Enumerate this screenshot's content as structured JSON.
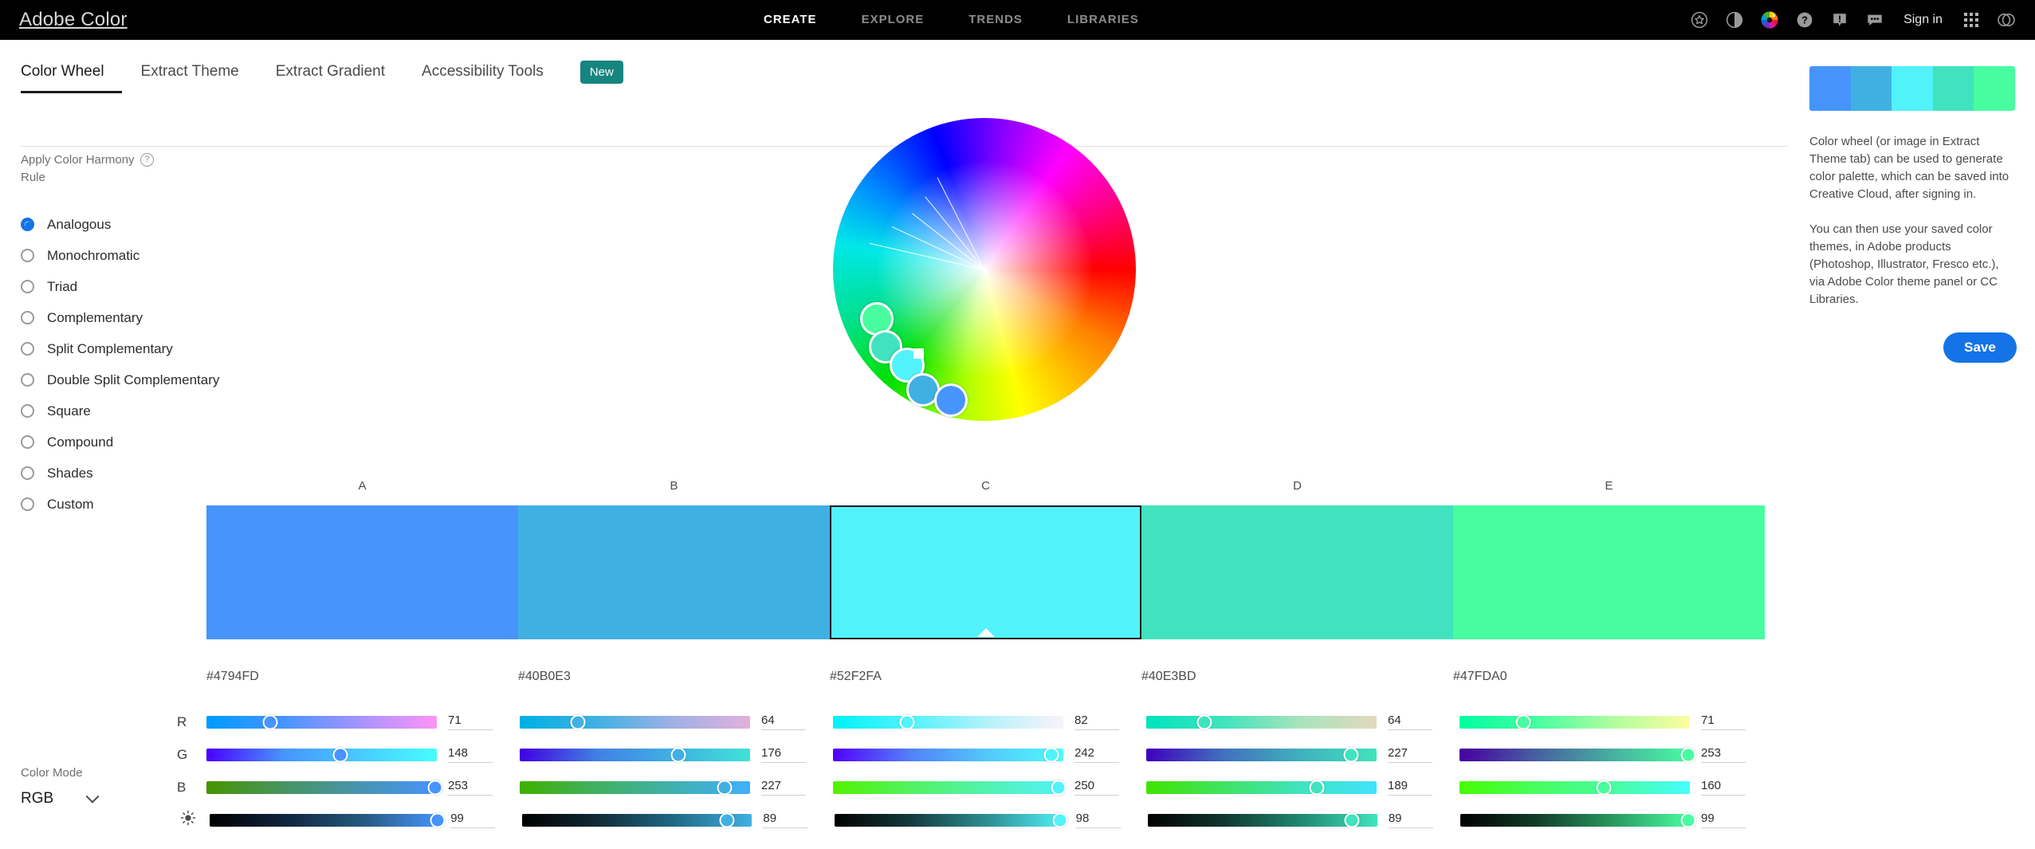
{
  "topbar": {
    "brand": "Adobe Color",
    "nav": [
      {
        "label": "CREATE",
        "active": true
      },
      {
        "label": "EXPLORE",
        "active": false
      },
      {
        "label": "TRENDS",
        "active": false
      },
      {
        "label": "LIBRARIES",
        "active": false
      }
    ],
    "signin_label": "Sign in",
    "icons": [
      "star-circle-icon",
      "contrast-toggle-icon",
      "color-wheel-icon",
      "help-icon",
      "announcement-icon",
      "feedback-chat-icon",
      "app-grid-icon",
      "creative-cloud-icon"
    ]
  },
  "tabs": [
    {
      "label": "Color Wheel",
      "active": true
    },
    {
      "label": "Extract Theme",
      "active": false
    },
    {
      "label": "Extract Gradient",
      "active": false
    },
    {
      "label": "Accessibility Tools",
      "active": false
    }
  ],
  "new_badge": "New",
  "left": {
    "harmony_label": "Apply Color Harmony Rule",
    "rules": [
      {
        "label": "Analogous",
        "selected": true
      },
      {
        "label": "Monochromatic",
        "selected": false
      },
      {
        "label": "Triad",
        "selected": false
      },
      {
        "label": "Complementary",
        "selected": false
      },
      {
        "label": "Split Complementary",
        "selected": false
      },
      {
        "label": "Double Split Complementary",
        "selected": false
      },
      {
        "label": "Square",
        "selected": false
      },
      {
        "label": "Compound",
        "selected": false
      },
      {
        "label": "Shades",
        "selected": false
      },
      {
        "label": "Custom",
        "selected": false
      }
    ],
    "color_mode_label": "Color Mode",
    "color_mode_value": "RGB"
  },
  "palette": {
    "labels": [
      "A",
      "B",
      "C",
      "D",
      "E"
    ],
    "hex": [
      "#4794FD",
      "#40B0E3",
      "#52F2FA",
      "#40E3BD",
      "#47FDA0"
    ],
    "selected_index": 2
  },
  "sliders": {
    "row_labels": [
      "R",
      "G",
      "B",
      "brightness-icon"
    ],
    "values": [
      {
        "R": "71",
        "G": "148",
        "B": "253",
        "Brightness": "99"
      },
      {
        "R": "64",
        "G": "176",
        "B": "227",
        "Brightness": "89"
      },
      {
        "R": "82",
        "G": "242",
        "B": "250",
        "Brightness": "98"
      },
      {
        "R": "64",
        "G": "227",
        "B": "189",
        "Brightness": "89"
      },
      {
        "R": "71",
        "G": "253",
        "B": "160",
        "Brightness": "99"
      }
    ]
  },
  "right": {
    "strip_colors": [
      "#4794FD",
      "#40B0E3",
      "#52F2FA",
      "#40E3BD",
      "#47FDA0"
    ],
    "paragraph1": "Color wheel (or image in Extract Theme tab) can be used to generate color palette, which can be saved into Creative Cloud, after signing in.",
    "paragraph2": "You can then use your saved color themes, in Adobe products (Photoshop, Illustrator, Fresco etc.), via Adobe Color theme panel or CC Libraries.",
    "save_label": "Save"
  },
  "accent": "#1473e6"
}
